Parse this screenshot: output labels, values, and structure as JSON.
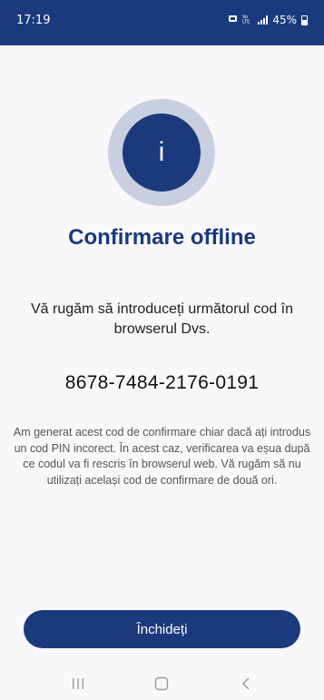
{
  "status_bar": {
    "time": "17:19",
    "battery": "45%",
    "icons": [
      "alarm-icon",
      "volte-icon",
      "signal-icon",
      "battery-icon"
    ],
    "background": "#1a3a7c"
  },
  "dialog": {
    "icon": "info-icon",
    "icon_glyph": "i",
    "title": "Confirmare offline",
    "instruction": "Vă rugăm să introduceți următorul cod în browserul Dvs.",
    "code": "8678-7484-2176-0191",
    "note": "Am generat acest cod de confirmare chiar dacă ați introdus un cod PIN incorect. În acest caz, verificarea va eșua după ce codul va fi rescris în browserul web. Vă rugăm să nu utilizați același cod de confirmare de două ori.",
    "close_label": "Închideți"
  },
  "nav_bar": {
    "items": [
      "recent-apps-icon",
      "home-icon",
      "back-icon"
    ]
  },
  "colors": {
    "primary": "#1a3a7c",
    "badge_ring": "#c9cfe0",
    "background": "#f8f8fa"
  }
}
